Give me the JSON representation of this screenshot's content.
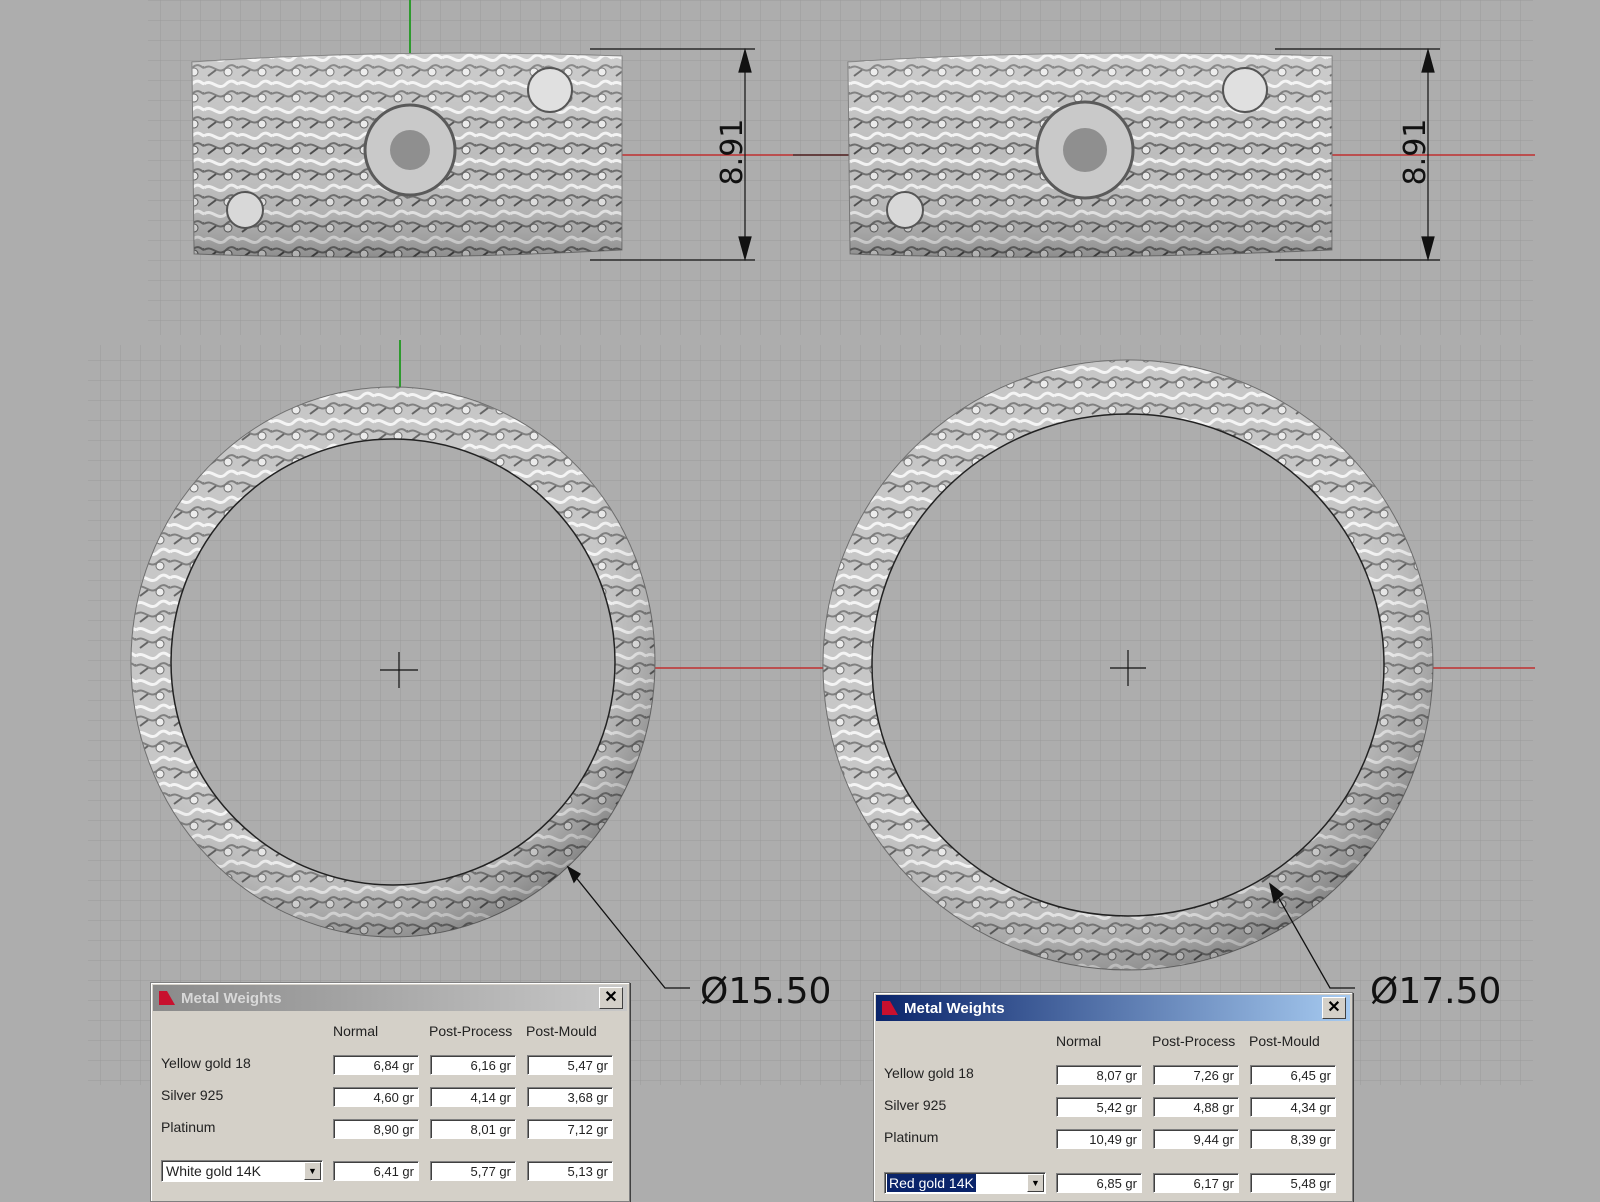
{
  "dimensions": {
    "height_label": "8.91",
    "diameter_left": "Ø15.50",
    "diameter_right": "Ø17.50"
  },
  "icons": {
    "app": "ruby-icon",
    "close": "close-icon",
    "dropdown": "chevron-down-icon"
  },
  "colors": {
    "x_axis": "#c03030",
    "y_axis": "#2e9a2e",
    "active_title": "#0a246a"
  },
  "dialogs": [
    {
      "title": "Metal Weights",
      "active": false,
      "close_label": "✕",
      "columns": [
        "Normal",
        "Post-Process",
        "Post-Mould"
      ],
      "rows": [
        {
          "label": "Yellow gold 18",
          "values": [
            "6,84 gr",
            "6,16 gr",
            "5,47 gr"
          ]
        },
        {
          "label": "Silver 925",
          "values": [
            "4,60 gr",
            "4,14 gr",
            "3,68 gr"
          ]
        },
        {
          "label": "Platinum",
          "values": [
            "8,90 gr",
            "8,01 gr",
            "7,12 gr"
          ]
        }
      ],
      "custom": {
        "selected": "White gold 14K",
        "values": [
          "6,41 gr",
          "5,77 gr",
          "5,13 gr"
        ]
      }
    },
    {
      "title": "Metal Weights",
      "active": true,
      "close_label": "✕",
      "columns": [
        "Normal",
        "Post-Process",
        "Post-Mould"
      ],
      "rows": [
        {
          "label": "Yellow gold 18",
          "values": [
            "8,07 gr",
            "7,26 gr",
            "6,45 gr"
          ]
        },
        {
          "label": "Silver 925",
          "values": [
            "5,42 gr",
            "4,88 gr",
            "4,34 gr"
          ]
        },
        {
          "label": "Platinum",
          "values": [
            "10,49 gr",
            "9,44 gr",
            "8,39 gr"
          ]
        }
      ],
      "custom": {
        "selected": "Red gold 14K",
        "values": [
          "6,85 gr",
          "6,17 gr",
          "5,48 gr"
        ]
      }
    }
  ]
}
